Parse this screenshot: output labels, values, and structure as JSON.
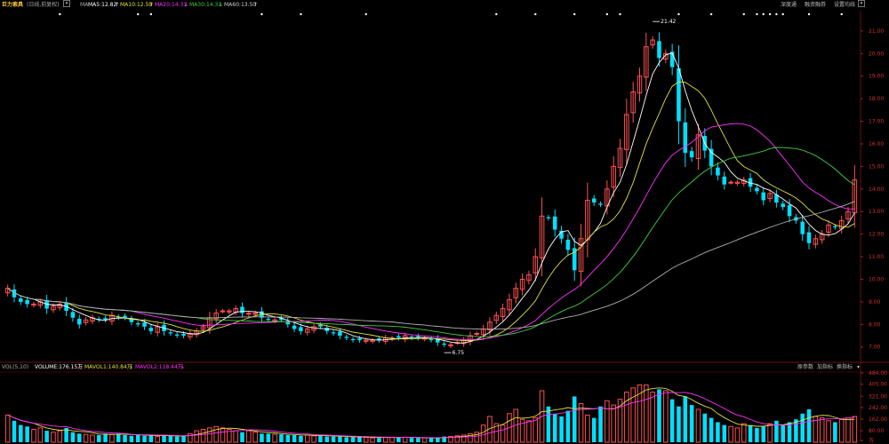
{
  "header": {
    "stock_name": "巨力索具",
    "period": "(日线,前复权)",
    "ma_label": "MA",
    "ma5": "MA5:12.82",
    "ma10": "MA10:12.59",
    "ma20": "MA20:14.31",
    "ma30": "MA30:14.31",
    "ma60": "MA60:13.50",
    "right_items": [
      "深度通",
      "融资融券",
      "设置均线"
    ]
  },
  "volume_header": {
    "title": "VOL(5,10)",
    "volume": "VOLUME:176.15万",
    "mavol1": "MAVOL1:140.84万",
    "mavol2": "MAVOL2:118.44万",
    "right_items": [
      "原参数",
      "加指标",
      "换指标"
    ]
  },
  "annotations": {
    "high": "21.42",
    "low": "6.75"
  },
  "colors": {
    "up": "#ff5050",
    "down": "#00e0ff",
    "ma5": "#ffffff",
    "ma10": "#e0e040",
    "ma20": "#ff30ff",
    "ma30": "#40d040",
    "ma60": "#b0b0b0"
  },
  "chart_data": {
    "type": "candlestick",
    "price_axis": {
      "ticks": [
        7.0,
        8.0,
        9.0,
        10.0,
        11.0,
        12.0,
        13.0,
        14.0,
        15.0,
        16.0,
        17.0,
        18.0,
        19.0,
        20.0,
        21.0
      ],
      "range": [
        6.4,
        21.9
      ]
    },
    "volume_axis": {
      "ticks": [
        "484.00",
        "405.00",
        "321.00",
        "242.00",
        "162.00",
        "80.00",
        "万"
      ],
      "range": [
        0,
        484
      ]
    },
    "series_legend": [
      "MA5",
      "MA10",
      "MA20",
      "MA30",
      "MA60"
    ],
    "candles_close": [
      9.6,
      9.2,
      9.0,
      8.9,
      8.9,
      9.0,
      8.7,
      8.8,
      8.9,
      8.6,
      8.3,
      8.0,
      8.2,
      8.3,
      8.2,
      8.2,
      8.4,
      8.3,
      8.3,
      8.1,
      8.0,
      7.9,
      7.7,
      7.9,
      7.7,
      7.6,
      7.5,
      7.5,
      7.6,
      7.7,
      7.9,
      8.3,
      8.5,
      8.6,
      8.6,
      8.7,
      8.5,
      8.5,
      8.5,
      8.3,
      8.2,
      8.2,
      8.2,
      8.0,
      7.8,
      7.7,
      7.8,
      7.9,
      7.9,
      7.7,
      7.6,
      7.5,
      7.4,
      7.3,
      7.3,
      7.3,
      7.3,
      7.3,
      7.4,
      7.4,
      7.4,
      7.5,
      7.4,
      7.4,
      7.4,
      7.3,
      7.2,
      7.1,
      7.1,
      7.2,
      7.3,
      7.5,
      7.6,
      7.8,
      8.1,
      8.4,
      8.7,
      9.1,
      9.6,
      10.0,
      10.2,
      11.0,
      12.8,
      12.7,
      12.2,
      11.8,
      11.3,
      10.4,
      11.8,
      13.5,
      13.4,
      13.3,
      14.0,
      15.0,
      15.8,
      17.3,
      18.3,
      19.0,
      20.3,
      20.6,
      19.8,
      20.0,
      19.4,
      17.0,
      15.6,
      15.4,
      16.4,
      15.7,
      15.0,
      14.6,
      14.2,
      14.3,
      14.3,
      14.4,
      14.1,
      13.9,
      13.5,
      13.8,
      13.4,
      13.2,
      12.8,
      12.6,
      12.0,
      11.6,
      11.8,
      12.0,
      12.4,
      12.3,
      12.6,
      13.0,
      14.4
    ],
    "volumes": [
      190,
      150,
      120,
      110,
      90,
      100,
      80,
      70,
      80,
      100,
      70,
      60,
      55,
      50,
      50,
      60,
      55,
      60,
      50,
      45,
      50,
      45,
      50,
      40,
      45,
      45,
      40,
      45,
      60,
      80,
      90,
      100,
      110,
      100,
      90,
      80,
      70,
      80,
      70,
      60,
      60,
      55,
      55,
      50,
      50,
      45,
      50,
      45,
      45,
      40,
      40,
      40,
      35,
      35,
      35,
      35,
      30,
      30,
      35,
      35,
      35,
      35,
      30,
      30,
      30,
      30,
      30,
      40,
      40,
      45,
      50,
      60,
      70,
      120,
      180,
      130,
      120,
      200,
      230,
      160,
      150,
      170,
      360,
      250,
      200,
      180,
      220,
      320,
      270,
      190,
      170,
      250,
      290,
      260,
      300,
      350,
      380,
      400,
      400,
      350,
      370,
      360,
      300,
      250,
      320,
      260,
      230,
      200,
      170,
      140,
      120,
      110,
      100,
      130,
      120,
      100,
      110,
      130,
      150,
      120,
      140,
      160,
      200,
      230,
      180,
      170,
      150,
      140,
      160,
      170,
      180
    ]
  }
}
